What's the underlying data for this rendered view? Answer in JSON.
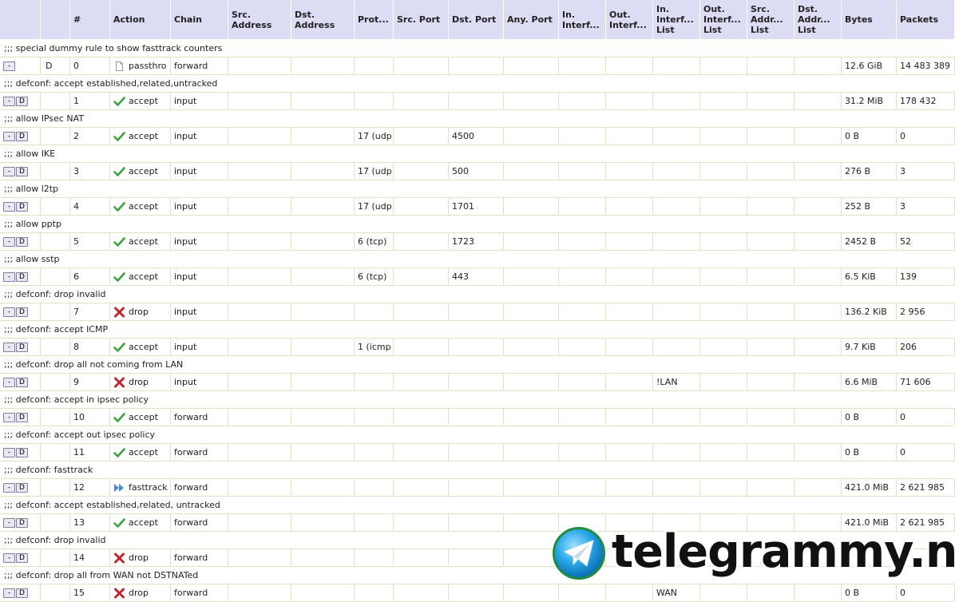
{
  "columns": [
    "",
    "",
    "#",
    "Action",
    "Chain",
    "Src. Address",
    "Dst. Address",
    "Prot...",
    "Src. Port",
    "Dst. Port",
    "Any. Port",
    "In. Interf...",
    "Out. Interf...",
    "In. Interf... List",
    "Out. Interf... List",
    "Src. Addr... List",
    "Dst. Addr... List",
    "Bytes",
    "Packets"
  ],
  "rules": [
    {
      "comment": ";;; special dummy rule to show fasttrack counters",
      "has_d_button": false,
      "flag": "D",
      "num": "0",
      "action": "passthro",
      "action_icon": "document-icon",
      "chain": "forward",
      "proto": "",
      "dst_port": "",
      "in_list": "",
      "bytes": "12.6 GiB",
      "packets": "14 483 389"
    },
    {
      "comment": ";;; defconf: accept established,related,untracked",
      "has_d_button": true,
      "flag": "",
      "num": "1",
      "action": "accept",
      "action_icon": "check-icon",
      "chain": "input",
      "proto": "",
      "dst_port": "",
      "in_list": "",
      "bytes": "31.2 MiB",
      "packets": "178 432"
    },
    {
      "comment": ";;; allow IPsec NAT",
      "has_d_button": true,
      "flag": "",
      "num": "2",
      "action": "accept",
      "action_icon": "check-icon",
      "chain": "input",
      "proto": "17 (udp",
      "dst_port": "4500",
      "in_list": "",
      "bytes": "0 B",
      "packets": "0"
    },
    {
      "comment": ";;; allow IKE",
      "has_d_button": true,
      "flag": "",
      "num": "3",
      "action": "accept",
      "action_icon": "check-icon",
      "chain": "input",
      "proto": "17 (udp",
      "dst_port": "500",
      "in_list": "",
      "bytes": "276 B",
      "packets": "3"
    },
    {
      "comment": ";;; allow l2tp",
      "has_d_button": true,
      "flag": "",
      "num": "4",
      "action": "accept",
      "action_icon": "check-icon",
      "chain": "input",
      "proto": "17 (udp",
      "dst_port": "1701",
      "in_list": "",
      "bytes": "252 B",
      "packets": "3"
    },
    {
      "comment": ";;; allow pptp",
      "has_d_button": true,
      "flag": "",
      "num": "5",
      "action": "accept",
      "action_icon": "check-icon",
      "chain": "input",
      "proto": "6 (tcp)",
      "dst_port": "1723",
      "in_list": "",
      "bytes": "2452 B",
      "packets": "52"
    },
    {
      "comment": ";;; allow sstp",
      "has_d_button": true,
      "flag": "",
      "num": "6",
      "action": "accept",
      "action_icon": "check-icon",
      "chain": "input",
      "proto": "6 (tcp)",
      "dst_port": "443",
      "in_list": "",
      "bytes": "6.5 KiB",
      "packets": "139"
    },
    {
      "comment": ";;; defconf: drop invalid",
      "has_d_button": true,
      "flag": "",
      "num": "7",
      "action": "drop",
      "action_icon": "x-icon",
      "chain": "input",
      "proto": "",
      "dst_port": "",
      "in_list": "",
      "bytes": "136.2 KiB",
      "packets": "2 956"
    },
    {
      "comment": ";;; defconf: accept ICMP",
      "has_d_button": true,
      "flag": "",
      "num": "8",
      "action": "accept",
      "action_icon": "check-icon",
      "chain": "input",
      "proto": "1 (icmp",
      "dst_port": "",
      "in_list": "",
      "bytes": "9.7 KiB",
      "packets": "206"
    },
    {
      "comment": ";;; defconf: drop all not coming from LAN",
      "has_d_button": true,
      "flag": "",
      "num": "9",
      "action": "drop",
      "action_icon": "x-icon",
      "chain": "input",
      "proto": "",
      "dst_port": "",
      "in_list": "!LAN",
      "bytes": "6.6 MiB",
      "packets": "71 606"
    },
    {
      "comment": ";;; defconf: accept in ipsec policy",
      "has_d_button": true,
      "flag": "",
      "num": "10",
      "action": "accept",
      "action_icon": "check-icon",
      "chain": "forward",
      "proto": "",
      "dst_port": "",
      "in_list": "",
      "bytes": "0 B",
      "packets": "0"
    },
    {
      "comment": ";;; defconf: accept out ipsec policy",
      "has_d_button": true,
      "flag": "",
      "num": "11",
      "action": "accept",
      "action_icon": "check-icon",
      "chain": "forward",
      "proto": "",
      "dst_port": "",
      "in_list": "",
      "bytes": "0 B",
      "packets": "0"
    },
    {
      "comment": ";;; defconf: fasttrack",
      "has_d_button": true,
      "flag": "",
      "num": "12",
      "action": "fasttrack",
      "action_icon": "fast-forward-icon",
      "chain": "forward",
      "proto": "",
      "dst_port": "",
      "in_list": "",
      "bytes": "421.0 MiB",
      "packets": "2 621 985"
    },
    {
      "comment": ";;; defconf: accept established,related, untracked",
      "has_d_button": true,
      "flag": "",
      "num": "13",
      "action": "accept",
      "action_icon": "check-icon",
      "chain": "forward",
      "proto": "",
      "dst_port": "",
      "in_list": "",
      "bytes": "421.0 MiB",
      "packets": "2 621 985"
    },
    {
      "comment": ";;; defconf: drop invalid",
      "has_d_button": true,
      "flag": "",
      "num": "14",
      "action": "drop",
      "action_icon": "x-icon",
      "chain": "forward",
      "proto": "",
      "dst_port": "",
      "in_list": "",
      "bytes": "",
      "packets": ""
    },
    {
      "comment": ";;; defconf: drop all from WAN not DSTNATed",
      "has_d_button": true,
      "flag": "",
      "num": "15",
      "action": "drop",
      "action_icon": "x-icon",
      "chain": "forward",
      "proto": "",
      "dst_port": "",
      "in_list": "WAN",
      "bytes": "0 B",
      "packets": "0"
    }
  ],
  "buttons": {
    "remove": "-",
    "disable": "D"
  },
  "colors": {
    "header_bg": "#dcdcf4",
    "grid": "#e2e2c6",
    "accept": "#3aa43a",
    "drop": "#c0242c",
    "fasttrack": "#3c8fd8"
  },
  "watermark": {
    "text": "telegrammy.net",
    "logo_icon": "telegram-paper-plane-icon"
  }
}
